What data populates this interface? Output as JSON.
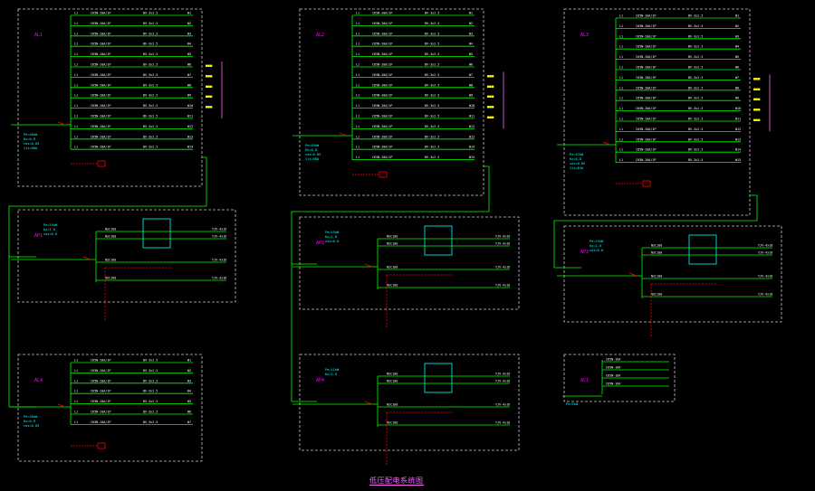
{
  "drawing": {
    "title_caption": "低压配电系统图",
    "colors": {
      "background": "#000000",
      "busbar": "#00ff00",
      "panel_border": "#c8c8c8",
      "breaker_text": "#ffffff",
      "feeder_tag": "#ffff00",
      "panel_name": "#ff00ff",
      "notes": "#00ffff",
      "dashed_circuit": "#ff0000",
      "meter_box": "#00ffff"
    }
  },
  "panels": [
    {
      "name": "AL1",
      "type": "distribution",
      "circuits": 14,
      "phase_label": "L1",
      "breaker_label": "C65N-20A/1P",
      "cable_label": "BV-3x2.5",
      "note_lines": [
        "Pe=40kW",
        "Kx=0.8",
        "cos=0.85",
        "Ijs=60A"
      ],
      "tag_group": 5
    },
    {
      "name": "AL2",
      "type": "distribution",
      "circuits": 15,
      "phase_label": "L1",
      "breaker_label": "C65N-20A/1P",
      "cable_label": "BV-3x2.5",
      "note_lines": [
        "Pe=45kW",
        "Kx=0.8",
        "cos=0.85",
        "Ijs=68A"
      ],
      "tag_group": 5
    },
    {
      "name": "AL3",
      "type": "distribution",
      "circuits": 15,
      "phase_label": "L1",
      "breaker_label": "C65N-20A/1P",
      "cable_label": "BV-3x2.5",
      "note_lines": [
        "Pe=42kW",
        "Kx=0.8",
        "cos=0.85",
        "Ijs=63A"
      ],
      "tag_group": 5
    },
    {
      "name": "AP1",
      "type": "motor",
      "circuits": 3,
      "phase_label": "L1",
      "breaker_label": "NSC100",
      "cable_label": "YJV-4x16",
      "note_lines": [
        "Pe=15kW",
        "Kx=1.0",
        "cos=0.8"
      ],
      "tag_group": 0
    },
    {
      "name": "AP2",
      "type": "motor",
      "circuits": 3,
      "phase_label": "L1",
      "breaker_label": "NSC100",
      "cable_label": "YJV-4x16",
      "note_lines": [
        "Pe=15kW",
        "Kx=1.0",
        "cos=0.8"
      ],
      "tag_group": 0
    },
    {
      "name": "AP3",
      "type": "motor",
      "circuits": 3,
      "phase_label": "L1",
      "breaker_label": "NSC100",
      "cable_label": "YJV-4x16",
      "note_lines": [
        "Pe=15kW",
        "Kx=1.0",
        "cos=0.8"
      ],
      "tag_group": 0
    },
    {
      "name": "AL4",
      "type": "distribution",
      "circuits": 7,
      "phase_label": "L1",
      "breaker_label": "C65N-20A/1P",
      "cable_label": "BV-3x2.5",
      "note_lines": [
        "Pe=20kW",
        "Kx=0.8",
        "cos=0.85"
      ],
      "tag_group": 0
    },
    {
      "name": "AP4",
      "type": "motor",
      "circuits": 3,
      "phase_label": "L1",
      "breaker_label": "NSC100",
      "cable_label": "YJV-4x16",
      "note_lines": [
        "Pe=11kW",
        "Kx=1.0"
      ],
      "tag_group": 0
    },
    {
      "name": "AC1",
      "type": "small",
      "circuits": 4,
      "phase_label": "L1",
      "breaker_label": "C65N-16A",
      "cable_label": "BV-3x2.5",
      "note_lines": [
        "Pe=5kW"
      ],
      "tag_group": 0
    }
  ]
}
